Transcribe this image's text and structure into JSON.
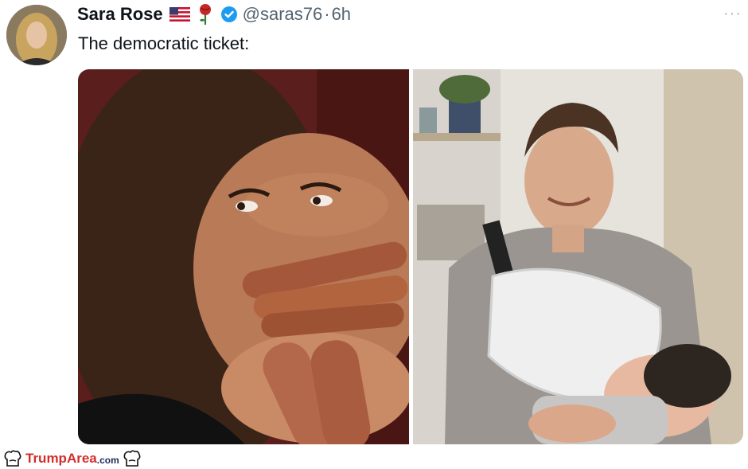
{
  "tweet": {
    "display_name": "Sara Rose",
    "handle": "@saras76",
    "separator": "·",
    "timestamp": "6h",
    "text": "The democratic ticket:",
    "more_icon": "more-horizontal-icon",
    "badge_icons": [
      "us-flag-icon",
      "rose-icon",
      "verified-badge-icon"
    ]
  },
  "footer": {
    "brand": "TrumpArea",
    "domain": ".com"
  },
  "colors": {
    "handle": "#536471",
    "verified": "#1d9bf0",
    "brand_red": "#d12e2b",
    "brand_navy": "#1e2a5a"
  }
}
